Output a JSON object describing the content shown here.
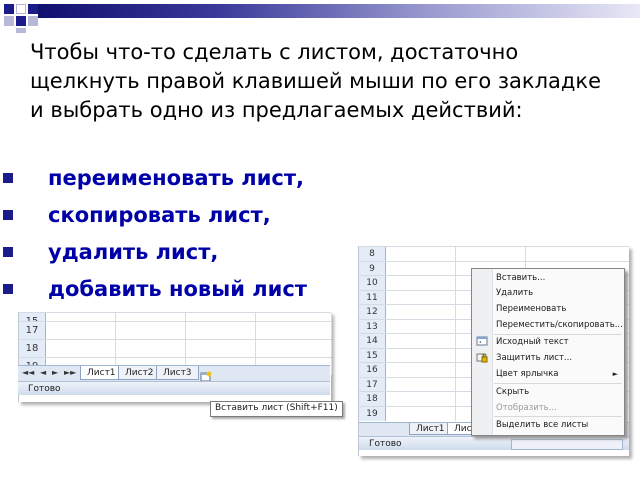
{
  "slide": {
    "intro_text": "Чтобы что-то сделать с листом, достаточно щелкнуть правой клавишей мыши по его закладке и выбрать одно из предлагаемых действий:",
    "bullets": [
      "переименовать лист,",
      "скопировать лист,",
      "удалить лист,",
      "добавить новый лист"
    ]
  },
  "left_excel": {
    "rows": [
      "15",
      "17",
      "18",
      "19"
    ],
    "nav_buttons": [
      "◄◄",
      "◄",
      "►",
      "►►"
    ],
    "sheet_tabs": [
      "Лист1",
      "Лист2",
      "Лист3"
    ],
    "status": "Готово",
    "tooltip": "Вставить лист (Shift+F11)"
  },
  "right_excel": {
    "rows": [
      "8",
      "9",
      "10",
      "11",
      "12",
      "13",
      "14",
      "15",
      "16",
      "17",
      "18",
      "19"
    ],
    "sheet_tabs": [
      "Лист1",
      "Лист2"
    ],
    "status": "Готово",
    "context_menu": {
      "items": [
        {
          "label": "Вставить...",
          "disabled": false
        },
        {
          "label": "Удалить",
          "disabled": false
        },
        {
          "label": "Переименовать",
          "disabled": false
        },
        {
          "label": "Переместить/скопировать...",
          "disabled": false
        },
        {
          "label": "Исходный текст",
          "disabled": false
        },
        {
          "label": "Защитить лист...",
          "disabled": false
        },
        {
          "label": "Цвет ярлычка",
          "disabled": false,
          "submenu": true
        },
        {
          "label": "Скрыть",
          "disabled": false
        },
        {
          "label": "Отобразить...",
          "disabled": true
        },
        {
          "label": "Выделить все листы",
          "disabled": false
        }
      ],
      "submenu_arrow": "►"
    }
  },
  "colors": {
    "bullet_text": "#0000a8",
    "bullet_mark": "#1b1b8c",
    "accent_bar_start": "#101070"
  }
}
